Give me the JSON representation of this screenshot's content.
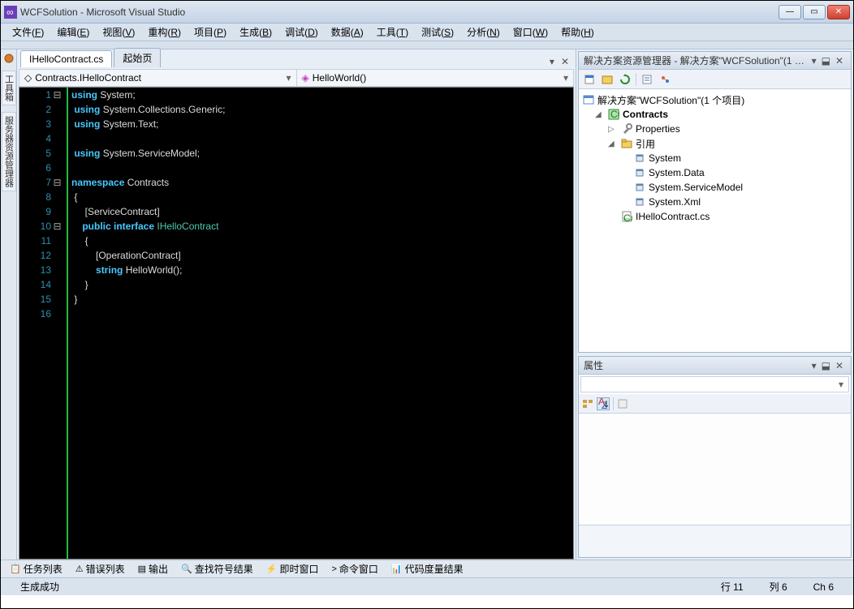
{
  "window": {
    "title": "WCFSolution - Microsoft Visual Studio"
  },
  "menu": [
    {
      "label": "文件",
      "key": "F"
    },
    {
      "label": "编辑",
      "key": "E"
    },
    {
      "label": "视图",
      "key": "V"
    },
    {
      "label": "重构",
      "key": "R"
    },
    {
      "label": "项目",
      "key": "P"
    },
    {
      "label": "生成",
      "key": "B"
    },
    {
      "label": "调试",
      "key": "D"
    },
    {
      "label": "数据",
      "key": "A"
    },
    {
      "label": "工具",
      "key": "T"
    },
    {
      "label": "测试",
      "key": "S"
    },
    {
      "label": "分析",
      "key": "N"
    },
    {
      "label": "窗口",
      "key": "W"
    },
    {
      "label": "帮助",
      "key": "H"
    }
  ],
  "left_tabs": [
    "工具箱",
    "服务器资源管理器"
  ],
  "file_tabs": {
    "active": "IHelloContract.cs",
    "inactive": "起始页"
  },
  "nav": {
    "left": "Contracts.IHelloContract",
    "right": "HelloWorld()"
  },
  "code_lines": [
    {
      "n": 1,
      "fold": "⊟",
      "html": "<span class='kw'>using</span> <span class='ns'>System;</span>"
    },
    {
      "n": 2,
      "fold": "",
      "html": " <span class='kw'>using</span> <span class='ns'>System.Collections.Generic;</span>"
    },
    {
      "n": 3,
      "fold": "",
      "html": " <span class='kw'>using</span> <span class='ns'>System.Text;</span>"
    },
    {
      "n": 4,
      "fold": "",
      "html": ""
    },
    {
      "n": 5,
      "fold": "",
      "html": " <span class='kw'>using</span> <span class='ns'>System.ServiceModel;</span>"
    },
    {
      "n": 6,
      "fold": "",
      "html": ""
    },
    {
      "n": 7,
      "fold": "⊟",
      "html": "<span class='kw'>namespace</span> <span class='ns'>Contracts</span>"
    },
    {
      "n": 8,
      "fold": "",
      "html": " {"
    },
    {
      "n": 9,
      "fold": "",
      "html": "     [ServiceContract]"
    },
    {
      "n": 10,
      "fold": "⊟",
      "html": "    <span class='kw'>public interface</span> <span class='typ'>IHelloContract</span>"
    },
    {
      "n": 11,
      "fold": "",
      "html": "     {"
    },
    {
      "n": 12,
      "fold": "",
      "html": "         [OperationContract]"
    },
    {
      "n": 13,
      "fold": "",
      "html": "         <span class='kw'>string</span> HelloWorld();"
    },
    {
      "n": 14,
      "fold": "",
      "html": "     }"
    },
    {
      "n": 15,
      "fold": "",
      "html": " }"
    },
    {
      "n": 16,
      "fold": "",
      "html": ""
    }
  ],
  "solution_panel": {
    "title": "解决方案资源管理器 - 解决方案\"WCFSolution\"(1 个 …",
    "root": "解决方案\"WCFSolution\"(1 个项目)",
    "project": "Contracts",
    "props": "Properties",
    "refs": "引用",
    "ref_items": [
      "System",
      "System.Data",
      "System.ServiceModel",
      "System.Xml"
    ],
    "file": "IHelloContract.cs"
  },
  "properties_panel": {
    "title": "属性"
  },
  "bottom_tabs": [
    "任务列表",
    "错误列表",
    "输出",
    "查找符号结果",
    "即时窗口",
    "命令窗口",
    "代码度量结果"
  ],
  "status": {
    "build": "生成成功",
    "line": "行 11",
    "col": "列 6",
    "ch": "Ch 6"
  }
}
